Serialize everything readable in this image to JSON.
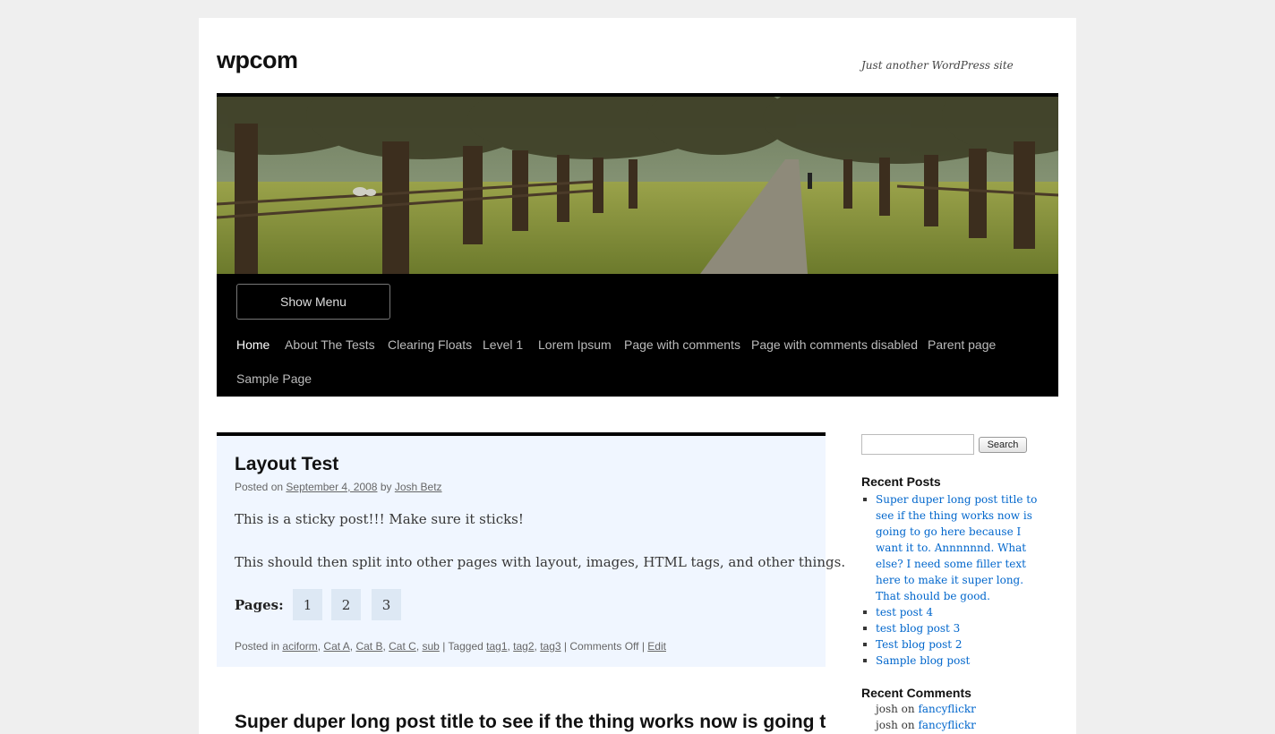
{
  "site": {
    "title": "wpcom",
    "description": "Just another WordPress site"
  },
  "nav": {
    "show_menu": "Show Menu",
    "items": [
      "Home",
      "About The Tests",
      "Clearing Floats",
      "Level 1",
      "Lorem Ipsum",
      "Page with comments",
      "Page with comments disabled",
      "Parent page",
      "Sample Page"
    ]
  },
  "post": {
    "title": "Layout Test",
    "posted_on": "Posted on",
    "date": "September 4, 2008",
    "by": "by",
    "author": "Josh Betz",
    "paragraph1": "This is a sticky post!!! Make sure it sticks!",
    "paragraph2": "This should then split into other pages with layout, images, HTML tags, and other things.",
    "pages_label": "Pages:",
    "pages": [
      "1",
      "2",
      "3"
    ],
    "footer": {
      "posted_in": "Posted in",
      "categories": [
        "aciform",
        "Cat A",
        "Cat B",
        "Cat C",
        "sub"
      ],
      "tagged": "| Tagged",
      "tags": [
        "tag1",
        "tag2",
        "tag3"
      ],
      "comments": "| Comments Off |",
      "edit": "Edit"
    }
  },
  "next_post_title": "Super duper long post title to see if the thing works now is going to",
  "sidebar": {
    "search_button": "Search",
    "search_value": "",
    "recent_posts_title": "Recent Posts",
    "recent_posts": [
      "Super duper long post title to see if the thing works now is going to go here because I want it to. Annnnnnd. What else? I need some filler text here to make it super long. That should be good.",
      "test post 4",
      "test blog post 3",
      "Test blog post 2",
      "Sample blog post"
    ],
    "recent_comments_title": "Recent Comments",
    "recent_comments": [
      {
        "author": "josh",
        "on": "on",
        "post": "fancyflickr"
      },
      {
        "author": "josh",
        "on": "on",
        "post": "fancyflickr"
      }
    ]
  }
}
